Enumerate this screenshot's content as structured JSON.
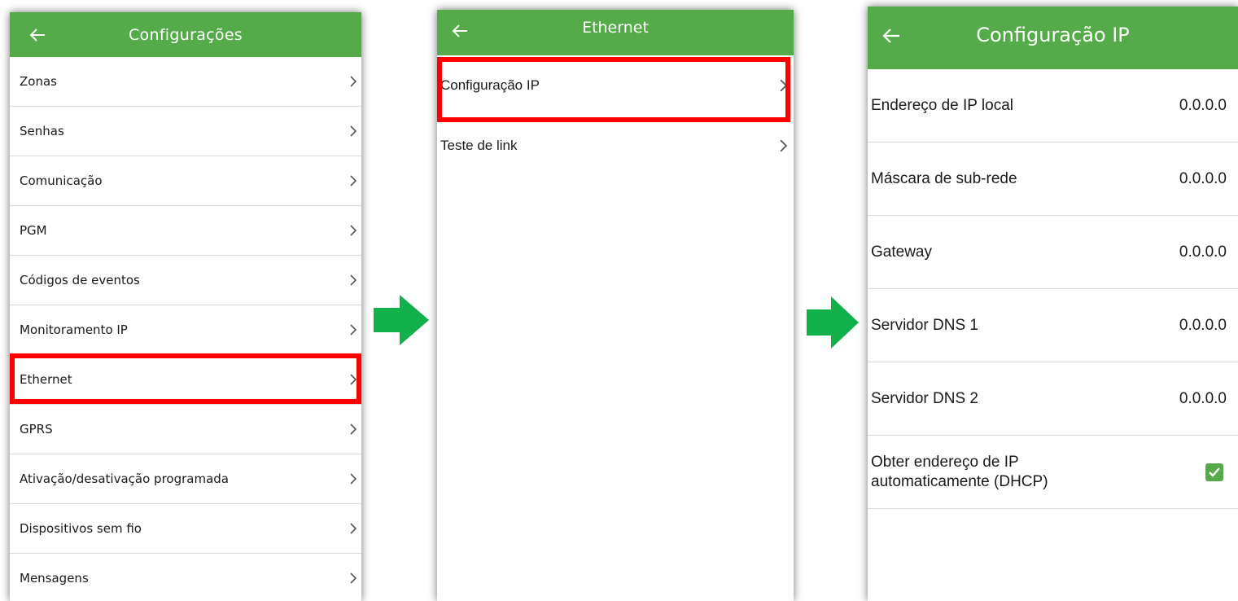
{
  "theme": {
    "accent": "#55ab4a",
    "highlight": "#ff0000",
    "arrow": "#11b04a"
  },
  "screen1": {
    "title": "Configurações",
    "items": [
      {
        "label": "Zonas"
      },
      {
        "label": "Senhas"
      },
      {
        "label": "Comunicação"
      },
      {
        "label": "PGM"
      },
      {
        "label": "Códigos de eventos"
      },
      {
        "label": "Monitoramento IP"
      },
      {
        "label": "Ethernet",
        "highlighted": true
      },
      {
        "label": "GPRS"
      },
      {
        "label": "Ativação/desativação programada"
      },
      {
        "label": "Dispositivos sem fio"
      },
      {
        "label": "Mensagens"
      }
    ]
  },
  "screen2": {
    "title": "Ethernet",
    "items": [
      {
        "label": "Configuração IP",
        "highlighted": true
      },
      {
        "label": "Teste de link"
      }
    ]
  },
  "screen3": {
    "title": "Configuração IP",
    "fields": [
      {
        "label": "Endereço de IP local",
        "value": "0.0.0.0"
      },
      {
        "label": "Máscara de sub-rede",
        "value": "0.0.0.0"
      },
      {
        "label": "Gateway",
        "value": "0.0.0.0"
      },
      {
        "label": "Servidor DNS 1",
        "value": "0.0.0.0"
      },
      {
        "label": "Servidor DNS 2",
        "value": "0.0.0.0"
      }
    ],
    "dhcp": {
      "label_line1": "Obter endereço de IP",
      "label_line2": "automaticamente (DHCP)",
      "checked": true
    }
  },
  "icons": {
    "back": "arrow-left-icon",
    "chevron": "chevron-right-icon",
    "flow": "arrow-right-icon",
    "check": "check-icon"
  }
}
